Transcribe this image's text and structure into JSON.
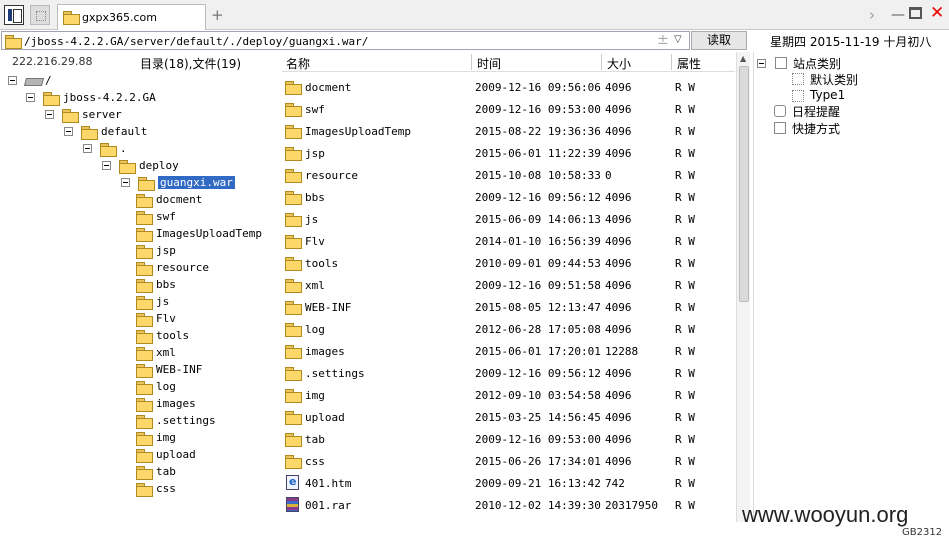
{
  "tab": {
    "title": "gxpx365.com"
  },
  "path_bar": {
    "path": "/jboss-4.2.2.GA/server/default/./deploy/guangxi.war/",
    "read_label": "读取"
  },
  "date_label": "星期四  2015-11-19  十月初八",
  "left_status": {
    "ip": "222.216.29.88",
    "dir_count": "目录(18),文件(19)"
  },
  "tree": [
    {
      "label": "/",
      "icon": "drive-icon",
      "toggle": true
    },
    {
      "label": "jboss-4.2.2.GA",
      "toggle": true
    },
    {
      "label": "server",
      "toggle": true
    },
    {
      "label": "default",
      "toggle": true
    },
    {
      "label": ".",
      "toggle": true
    },
    {
      "label": "deploy",
      "toggle": true
    },
    {
      "label": "guangxi.war",
      "toggle": true,
      "selected": true
    },
    {
      "label": "docment"
    },
    {
      "label": "swf"
    },
    {
      "label": "ImagesUploadTemp"
    },
    {
      "label": "jsp"
    },
    {
      "label": "resource"
    },
    {
      "label": "bbs"
    },
    {
      "label": "js"
    },
    {
      "label": "Flv"
    },
    {
      "label": "tools"
    },
    {
      "label": "xml"
    },
    {
      "label": "WEB-INF"
    },
    {
      "label": "log"
    },
    {
      "label": "images"
    },
    {
      "label": ".settings"
    },
    {
      "label": "img"
    },
    {
      "label": "upload"
    },
    {
      "label": "tab"
    },
    {
      "label": "css"
    }
  ],
  "list_columns": {
    "name": "名称",
    "time": "时间",
    "size": "大小",
    "attr": "属性"
  },
  "files": [
    {
      "name": "docment",
      "time": "2009-12-16 09:56:06",
      "size": "4096",
      "attr": "R W",
      "icon": "folder-icon"
    },
    {
      "name": "swf",
      "time": "2009-12-16 09:53:00",
      "size": "4096",
      "attr": "R W",
      "icon": "folder-icon"
    },
    {
      "name": "ImagesUploadTemp",
      "time": "2015-08-22 19:36:36",
      "size": "4096",
      "attr": "R W",
      "icon": "folder-icon"
    },
    {
      "name": "jsp",
      "time": "2015-06-01 11:22:39",
      "size": "4096",
      "attr": "R W",
      "icon": "folder-icon"
    },
    {
      "name": "resource",
      "time": "2015-10-08 10:58:33",
      "size": "0",
      "attr": "R W",
      "icon": "folder-icon"
    },
    {
      "name": "bbs",
      "time": "2009-12-16 09:56:12",
      "size": "4096",
      "attr": "R W",
      "icon": "folder-icon"
    },
    {
      "name": "js",
      "time": "2015-06-09 14:06:13",
      "size": "4096",
      "attr": "R W",
      "icon": "folder-icon"
    },
    {
      "name": "Flv",
      "time": "2014-01-10 16:56:39",
      "size": "4096",
      "attr": "R W",
      "icon": "folder-icon"
    },
    {
      "name": "tools",
      "time": "2010-09-01 09:44:53",
      "size": "4096",
      "attr": "R W",
      "icon": "folder-icon"
    },
    {
      "name": "xml",
      "time": "2009-12-16 09:51:58",
      "size": "4096",
      "attr": "R W",
      "icon": "folder-icon"
    },
    {
      "name": "WEB-INF",
      "time": "2015-08-05 12:13:47",
      "size": "4096",
      "attr": "R W",
      "icon": "folder-icon"
    },
    {
      "name": "log",
      "time": "2012-06-28 17:05:08",
      "size": "4096",
      "attr": "R W",
      "icon": "folder-icon"
    },
    {
      "name": "images",
      "time": "2015-06-01 17:20:01",
      "size": "12288",
      "attr": "R W",
      "icon": "folder-icon"
    },
    {
      "name": ".settings",
      "time": "2009-12-16 09:56:12",
      "size": "4096",
      "attr": "R W",
      "icon": "folder-icon"
    },
    {
      "name": "img",
      "time": "2012-09-10 03:54:58",
      "size": "4096",
      "attr": "R W",
      "icon": "folder-icon"
    },
    {
      "name": "upload",
      "time": "2015-03-25 14:56:45",
      "size": "4096",
      "attr": "R W",
      "icon": "folder-icon"
    },
    {
      "name": "tab",
      "time": "2009-12-16 09:53:00",
      "size": "4096",
      "attr": "R W",
      "icon": "folder-icon"
    },
    {
      "name": "css",
      "time": "2015-06-26 17:34:01",
      "size": "4096",
      "attr": "R W",
      "icon": "folder-icon"
    },
    {
      "name": "401.htm",
      "time": "2009-09-21 16:13:42",
      "size": "742",
      "attr": "R W",
      "icon": "html-file-icon"
    },
    {
      "name": "001.rar",
      "time": "2010-12-02 14:39:30",
      "size": "20317950",
      "attr": "R W",
      "icon": "rar-file-icon"
    }
  ],
  "right_panel": {
    "site_category": "站点类别",
    "default_category": "默认类别",
    "type1": "Type1",
    "schedule": "日程提醒",
    "shortcut": "快捷方式"
  },
  "watermark": "www.wooyun.org",
  "encoding": "GB2312",
  "colors": {
    "selection": "#316ac5",
    "folder": "#fcd86a",
    "close": "#ee0000"
  }
}
